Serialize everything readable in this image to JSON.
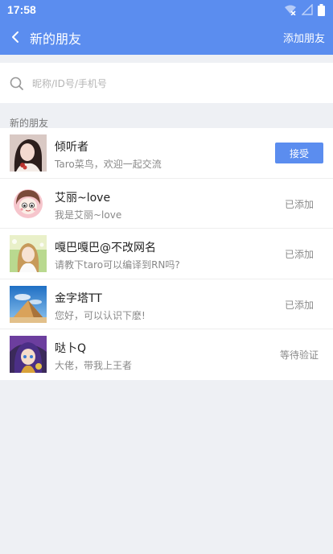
{
  "statusbar": {
    "time": "17:58",
    "icons": [
      "wifi-off-icon",
      "signal-icon",
      "battery-icon"
    ]
  },
  "nav": {
    "back_icon": "chevron-left-icon",
    "title": "新的朋友",
    "action": "添加朋友"
  },
  "search": {
    "icon": "search-icon",
    "placeholder": "昵称/ID号/手机号"
  },
  "section_title": "新的朋友",
  "friends": [
    {
      "name": "倾听者",
      "message": "Taro菜鸟，欢迎一起交流",
      "action": "接受"
    },
    {
      "name": "艾丽~love",
      "message": "我是艾丽~love",
      "status": "已添加"
    },
    {
      "name": "嘎巴嘎巴@不改网名",
      "message": "请教下taro可以编译到RN吗?",
      "status": "已添加"
    },
    {
      "name": "金字塔TT",
      "message": "您好，可以认识下麽!",
      "status": "已添加"
    },
    {
      "name": "哒卜Q",
      "message": "大佬，带我上王者",
      "status": "等待验证"
    }
  ],
  "colors": {
    "primary": "#5b8def",
    "background": "#eef0f4"
  }
}
